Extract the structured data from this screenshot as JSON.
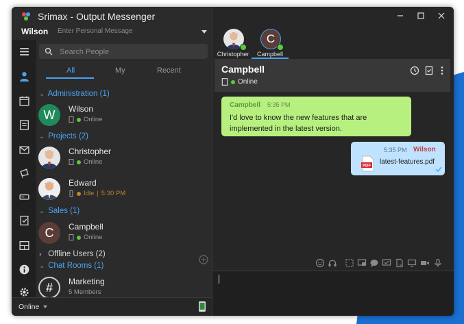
{
  "app": {
    "title": "Srimax - Output Messenger"
  },
  "user": {
    "name": "Wilson",
    "personal_message_placeholder": "Enter Personal Message",
    "status": "Online"
  },
  "search": {
    "placeholder": "Search People"
  },
  "tabs": [
    {
      "label": "All",
      "active": true
    },
    {
      "label": "My"
    },
    {
      "label": "Recent"
    }
  ],
  "groups": {
    "administration": "Administration (1)",
    "projects": "Projects (2)",
    "sales": "Sales (1)",
    "offline": "Offline Users (2)",
    "chat_rooms": "Chat Rooms (1)"
  },
  "contacts": {
    "wilson": {
      "name": "Wilson",
      "status": "Online",
      "initial": "W"
    },
    "christopher": {
      "name": "Christopher",
      "status": "Online"
    },
    "edward": {
      "name": "Edward",
      "status": "Idle",
      "time": "5:30 PM"
    },
    "campbell": {
      "name": "Campbell",
      "status": "Online",
      "initial": "C"
    }
  },
  "rooms": {
    "marketing": {
      "name": "Marketing",
      "members": "5 Members"
    }
  },
  "chat_tabs": [
    {
      "label": "Christopher"
    },
    {
      "label": "Campbell",
      "active": true
    }
  ],
  "chat": {
    "name": "Campbell",
    "status": "Online",
    "messages": [
      {
        "from": "Campbell",
        "time": "5:35 PM",
        "text": "I'd love to know the new features that are implemented in the latest version."
      },
      {
        "from": "Wilson",
        "time": "5:35 PM",
        "file": "latest-features.pdf"
      }
    ]
  },
  "colors": {
    "accent": "#4aa3f0",
    "online": "#5cc93d",
    "idle": "#b8862e",
    "incoming": "#b7f07f",
    "outgoing": "#bfe3ff"
  },
  "icons": {
    "sidebar": [
      "menu-icon",
      "contacts-icon",
      "calendar-icon",
      "notes-icon",
      "mail-icon",
      "announcement-icon",
      "drive-icon",
      "tasks-icon",
      "board-icon",
      "info-icon",
      "settings-icon"
    ],
    "composer_toolbar": [
      "emoji-icon",
      "headset-icon",
      "screenshot-icon",
      "screen-share-icon",
      "chat-bubble-icon",
      "chat-reply-icon",
      "file-send-icon",
      "screen-icon",
      "video-icon",
      "voice-icon"
    ]
  }
}
